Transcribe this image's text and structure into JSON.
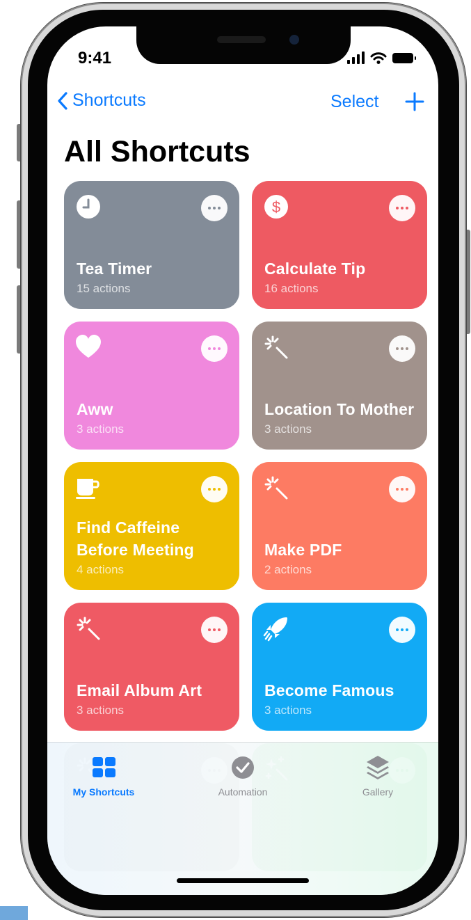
{
  "status_bar": {
    "time": "9:41"
  },
  "nav": {
    "back_label": "Shortcuts",
    "select_label": "Select"
  },
  "page_title": "All Shortcuts",
  "colors": {
    "accent": "#0a7aff",
    "tab_inactive": "#8e8e93"
  },
  "shortcuts": [
    {
      "title": "Tea Timer",
      "subtitle": "15 actions",
      "color": "#838c98",
      "icon": "clock-icon"
    },
    {
      "title": "Calculate Tip",
      "subtitle": "16 actions",
      "color": "#ee5a62",
      "icon": "dollar-icon"
    },
    {
      "title": "Aww",
      "subtitle": "3 actions",
      "color": "#f088dd",
      "icon": "heart-icon"
    },
    {
      "title": "Location To Mother",
      "subtitle": "3 actions",
      "color": "#a1928c",
      "icon": "magic-wand-icon"
    },
    {
      "title": "Find Caffeine Before Meeting",
      "subtitle": "4 actions",
      "color": "#eebe00",
      "icon": "coffee-cup-icon"
    },
    {
      "title": "Make PDF",
      "subtitle": "2 actions",
      "color": "#fd7b63",
      "icon": "magic-wand-icon"
    },
    {
      "title": "Email Album Art",
      "subtitle": "3 actions",
      "color": "#ef5a64",
      "icon": "magic-wand-icon"
    },
    {
      "title": "Become Famous",
      "subtitle": "3 actions",
      "color": "#12aaf5",
      "icon": "rocket-icon"
    },
    {
      "title": "",
      "subtitle": "",
      "color": "#959b98",
      "icon": "magic-wand-icon"
    },
    {
      "title": "",
      "subtitle": "",
      "color": "#45c061",
      "icon": "sparkles-icon"
    }
  ],
  "tab_bar": [
    {
      "label": "My Shortcuts",
      "icon": "grid-icon",
      "selected": true
    },
    {
      "label": "Automation",
      "icon": "clock-check-icon",
      "selected": false
    },
    {
      "label": "Gallery",
      "icon": "layers-icon",
      "selected": false
    }
  ]
}
